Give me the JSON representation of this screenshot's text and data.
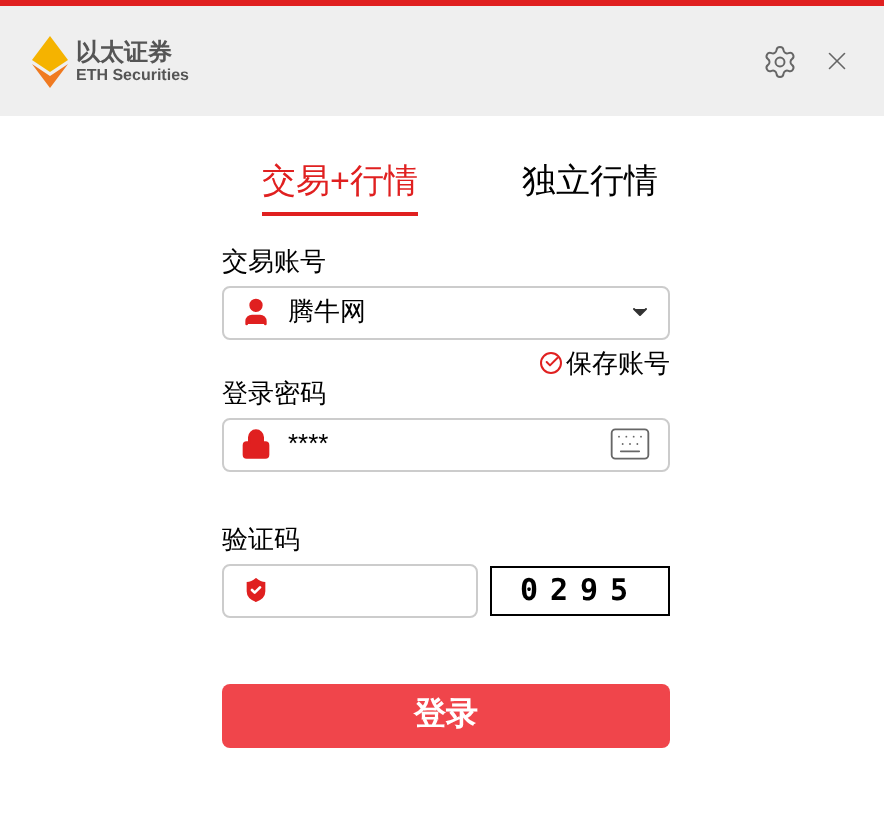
{
  "logo": {
    "name": "以太证券",
    "subtitle": "ETH Securities"
  },
  "tabs": [
    {
      "label": "交易+行情",
      "selected": true
    },
    {
      "label": "独立行情",
      "selected": false
    }
  ],
  "account": {
    "label": "交易账号",
    "value": "腾牛网"
  },
  "save_account": {
    "label": "保存账号",
    "checked": true
  },
  "password": {
    "label": "登录密码",
    "value": "****"
  },
  "captcha": {
    "label": "验证码",
    "code": "0295"
  },
  "login_button": "登录"
}
